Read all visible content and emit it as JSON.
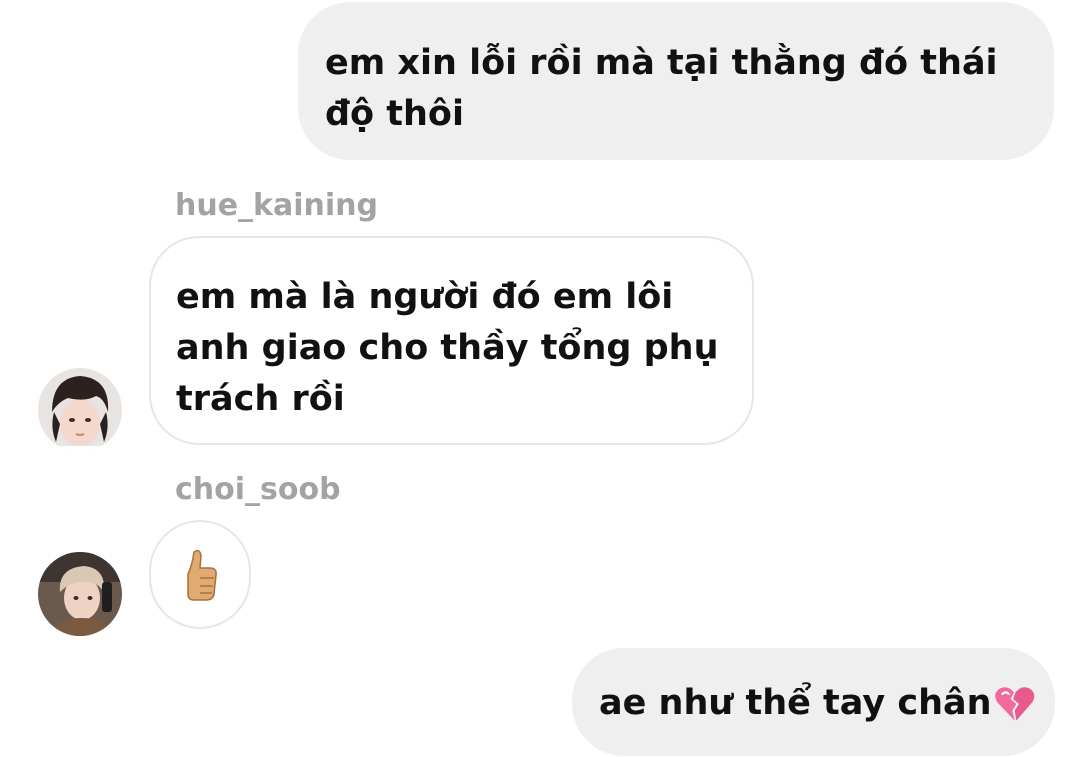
{
  "messages": [
    {
      "direction": "outgoing",
      "lines": [
        "em xin lỗi rồi mà tại thằng đó thái",
        "độ thôi"
      ]
    },
    {
      "direction": "incoming",
      "sender": "hue_kaining",
      "avatar_icon": "avatar-hue-kaining",
      "lines": [
        "em mà là người đó em lôi",
        "anh giao cho thầy tổng phụ",
        "trách rồi"
      ]
    },
    {
      "direction": "incoming",
      "sender": "choi_soob",
      "avatar_icon": "avatar-choi-soob",
      "emoji": "👍",
      "emoji_icon": "thumbs-up-icon"
    },
    {
      "direction": "outgoing",
      "text": "ae như thể tay chân",
      "emoji": "💔",
      "emoji_icon": "broken-heart-icon"
    }
  ],
  "colors": {
    "outgoing_bubble": "#efefef",
    "incoming_border": "#e6e6e6",
    "sender_name": "#a3a3a3",
    "text": "#111111"
  }
}
